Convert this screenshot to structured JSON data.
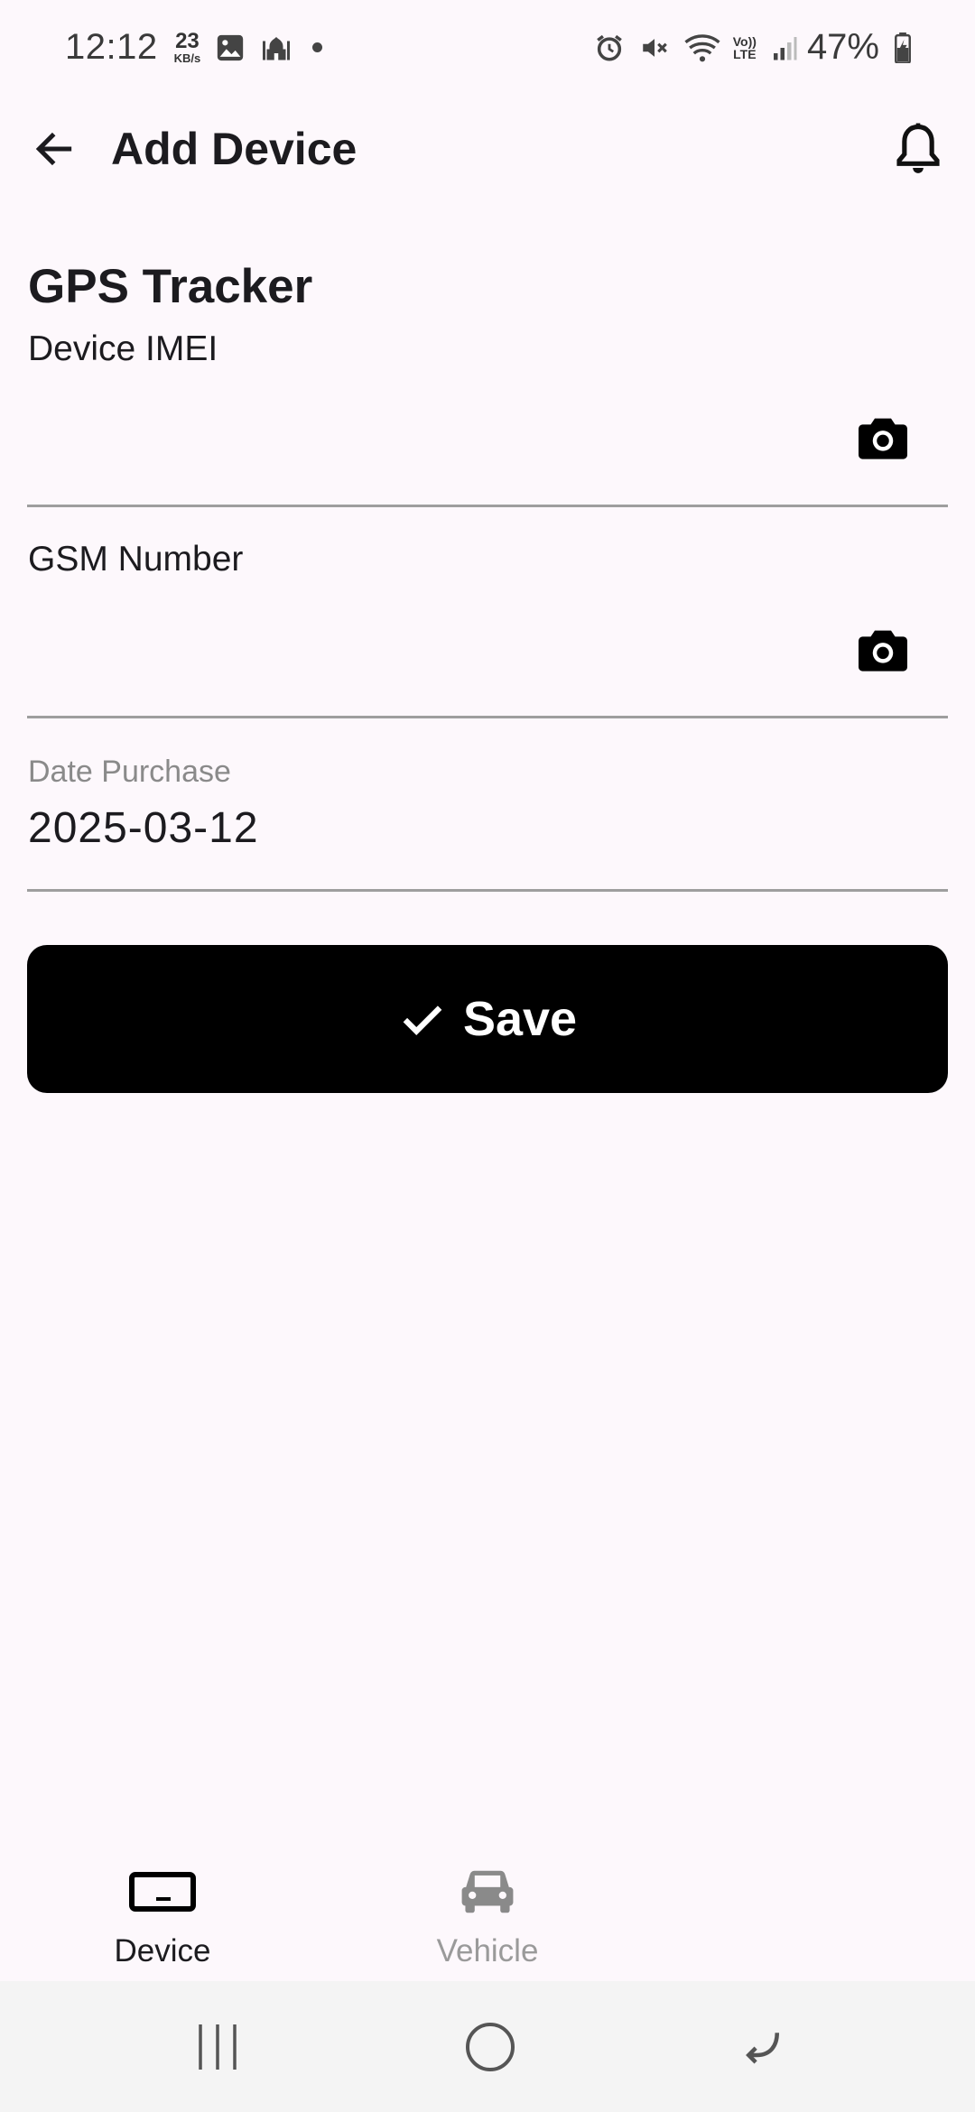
{
  "status_bar": {
    "time": "12:12",
    "speed_value": "23",
    "speed_unit": "KB/s",
    "network_label_top": "Vo))",
    "network_label_bottom": "LTE",
    "battery": "47%"
  },
  "app_bar": {
    "title": "Add Device"
  },
  "form": {
    "section_title": "GPS Tracker",
    "imei": {
      "label": "Device IMEI",
      "value": ""
    },
    "gsm": {
      "label": "GSM Number",
      "value": ""
    },
    "date": {
      "label": "Date Purchase",
      "value": "2025-03-12"
    },
    "save_label": "Save"
  },
  "bottom_nav": {
    "items": [
      {
        "label": "Device",
        "active": true
      },
      {
        "label": "Vehicle",
        "active": false
      }
    ]
  },
  "icons": {
    "back": "arrow-back-icon",
    "bell": "bell-icon",
    "camera": "camera-icon",
    "check": "check-icon",
    "device": "device-icon",
    "car": "car-icon"
  },
  "colors": {
    "background": "#fdf8fc",
    "primary_button": "#000000",
    "underline": "#9e9e9e",
    "inactive": "#9a9a9a"
  }
}
